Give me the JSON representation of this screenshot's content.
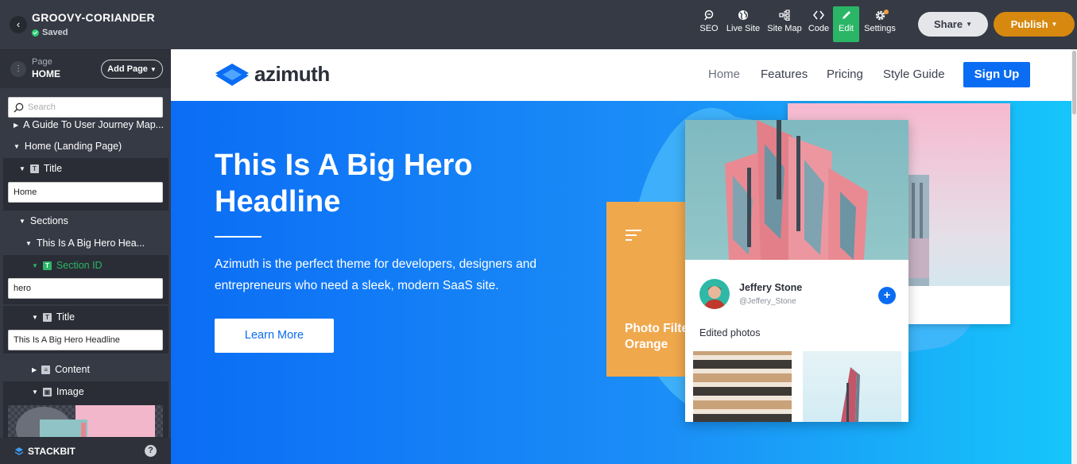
{
  "topbar": {
    "project_name": "GROOVY-CORIANDER",
    "status": "Saved",
    "tools": {
      "seo": "SEO",
      "live_site": "Live Site",
      "site_map": "Site Map",
      "code": "Code",
      "edit": "Edit",
      "settings": "Settings"
    },
    "share_label": "Share",
    "publish_label": "Publish"
  },
  "sidebar": {
    "page_caption": "Page",
    "page_name": "HOME",
    "add_page_label": "Add Page",
    "search_placeholder": "Search",
    "tree": {
      "guide_item": "A Guide To User Journey Map...",
      "home_item": "Home (Landing Page)",
      "title_label": "Title",
      "title_value": "Home",
      "sections_label": "Sections",
      "hero_section": "This Is A Big Hero Hea...",
      "section_id_label": "Section ID",
      "section_id_value": "hero",
      "hero_title_label": "Title",
      "hero_title_value": "This Is A Big Hero Headline",
      "content_label": "Content",
      "image_label": "Image"
    },
    "footer_brand": "STACKBIT",
    "help_label": "?"
  },
  "site": {
    "logo_text": "azimuth",
    "nav": [
      "Home",
      "Features",
      "Pricing",
      "Style Guide"
    ],
    "signup_label": "Sign Up",
    "hero": {
      "title": "This Is A Big Hero Headline",
      "text": "Azimuth is the perfect theme for developers, designers and entrepreneurs who need a sleek, modern SaaS site.",
      "button_label": "Learn More"
    },
    "cards": {
      "orange_text_line1": "Photo Filte",
      "orange_text_line2": "Orange",
      "profile_name": "Jeffery Stone",
      "profile_handle": "@Jeffery_Stone",
      "edited_label": "Edited photos"
    }
  },
  "colors": {
    "topbar_bg": "#363a45",
    "edit_green": "#2ab666",
    "publish_orange": "#d6880f",
    "brand_blue": "#0a6cf2",
    "hero_gradient_start": "#0b6df5",
    "hero_gradient_end": "#16c6fa",
    "orange_card": "#f0a84d"
  }
}
